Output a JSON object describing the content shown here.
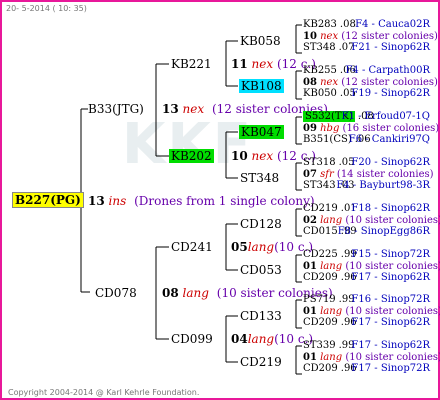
{
  "header": {
    "date_text": "20- 5-2014 ( 10: 35)"
  },
  "footer": {
    "copyright": "Copyright 2004-2014 @ Karl Kehrle Foundation."
  },
  "root": {
    "name": "B227(PG)",
    "year": "13",
    "race": "ins",
    "note": "(Drones from 1 single colony)"
  },
  "gen1": {
    "top": {
      "name": "B33(JTG)",
      "year": "13",
      "race": "nex",
      "note": "(12 sister colonies)"
    },
    "bottom": {
      "name": "CD078",
      "year": "08",
      "race": "lang",
      "note": "(10 sister colonies)"
    }
  },
  "gen2": {
    "kb221": {
      "name": "KB221",
      "year": "11",
      "race": "nex",
      "note": "(12 c.)"
    },
    "kb202": {
      "name": "KB202",
      "year": "10",
      "race": "nex",
      "note": "(12 c.)"
    },
    "cd241": {
      "name": "CD241",
      "year": "05",
      "race": "lang",
      "note": "(10 c.)"
    },
    "cd099": {
      "name": "CD099",
      "year": "04",
      "race": "lang",
      "note": "(10 c.)"
    }
  },
  "gen3": {
    "kb058": "KB058",
    "kb108": "KB108",
    "kb047": "KB047",
    "st348": "ST348",
    "cd128": "CD128",
    "cd053": "CD053",
    "cd133": "CD133",
    "cd219": "CD219"
  },
  "gen4": [
    {
      "top": {
        "name": "KB283",
        "yr": ".08",
        "right": "F4 - Cauca02R"
      },
      "mid": {
        "year": "10",
        "race": "nex",
        "note": "(12 sister colonies)"
      },
      "bot": {
        "name": "ST348",
        "yr": ".07",
        "right": "F21 - Sinop62R"
      }
    },
    {
      "top": {
        "name": "KB255",
        "yr": ".06",
        "right": "F4 - Carpath00R"
      },
      "mid": {
        "year": "08",
        "race": "nex",
        "note": "(12 sister colonies)"
      },
      "bot": {
        "name": "KB050",
        "yr": ".05",
        "right": "F19 - Sinop62R"
      }
    },
    {
      "top": {
        "name": "S532(TK)",
        "yr": ".08",
        "right": "F1 - Erfoud07-1Q"
      },
      "mid": {
        "year": "09",
        "race": "hbg",
        "note": "(16 sister colonies)"
      },
      "bot": {
        "name": "B351(CS)",
        "yr": ".06",
        "right": "F6 - Cankiri97Q"
      }
    },
    {
      "top": {
        "name": "ST318",
        "yr": ".05",
        "right": "F20 - Sinop62R"
      },
      "mid": {
        "year": "07",
        "race": "sfr",
        "note": "(14 sister colonies)"
      },
      "bot": {
        "name": "ST343",
        "yr": ".03",
        "right": "F4 - Bayburt98-3R"
      }
    },
    {
      "top": {
        "name": "CD219",
        "yr": ".01",
        "right": "F18 - Sinop62R"
      },
      "mid": {
        "year": "02",
        "race": "lang",
        "note": "(10 sister colonies)"
      },
      "bot": {
        "name": "CD015",
        "yr": ".99",
        "right": "F8 - SinopEgg86R"
      }
    },
    {
      "top": {
        "name": "CD225",
        "yr": ".99",
        "right": "F15 - Sinop72R"
      },
      "mid": {
        "year": "01",
        "race": "lang",
        "note": "(10 sister colonies)"
      },
      "bot": {
        "name": "CD209",
        "yr": ".96",
        "right": "F17 - Sinop62R"
      }
    },
    {
      "top": {
        "name": "PS719",
        "yr": ".99",
        "right": "F16 - Sinop72R"
      },
      "mid": {
        "year": "01",
        "race": "lang",
        "note": "(10 sister colonies)"
      },
      "bot": {
        "name": "CD209",
        "yr": ".96",
        "right": "F17 - Sinop62R"
      }
    },
    {
      "top": {
        "name": "ST339",
        "yr": ".99",
        "right": "F17 - Sinop62R"
      },
      "mid": {
        "year": "01",
        "race": "lang",
        "note": "(10 sister colonies)"
      },
      "bot": {
        "name": "CD209",
        "yr": ".96",
        "right": "F17 - Sinop72R"
      }
    }
  ],
  "colors": {
    "frame": "#e8189a",
    "race": "#cc0000",
    "note": "#6600aa",
    "code": "#0000bb",
    "root_bg": "#ffff00",
    "kb108_bg": "#00e0ff",
    "kb047_bg": "#00dd00"
  }
}
